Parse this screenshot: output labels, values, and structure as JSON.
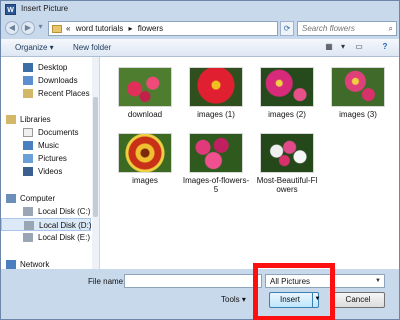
{
  "window": {
    "title": "Insert Picture",
    "app_icon_letter": "W"
  },
  "address": {
    "prefix": "«",
    "segments": [
      "word tutorials",
      "flowers"
    ],
    "separator": "▸",
    "search_placeholder": "Search flowers"
  },
  "toolbar": {
    "organize": "Organize ▾",
    "new_folder": "New folder"
  },
  "nav": {
    "items": [
      {
        "label": "Desktop",
        "icon": "desktop-icon"
      },
      {
        "label": "Downloads",
        "icon": "downloads-icon"
      },
      {
        "label": "Recent Places",
        "icon": "recent-places-icon"
      },
      {
        "label": "Libraries",
        "icon": "libraries-icon"
      },
      {
        "label": "Documents",
        "icon": "documents-icon"
      },
      {
        "label": "Music",
        "icon": "music-icon"
      },
      {
        "label": "Pictures",
        "icon": "pictures-icon"
      },
      {
        "label": "Videos",
        "icon": "videos-icon"
      },
      {
        "label": "Computer",
        "icon": "computer-icon"
      },
      {
        "label": "Local Disk (C:)",
        "icon": "disk-icon"
      },
      {
        "label": "Local Disk (D:)",
        "icon": "disk-icon"
      },
      {
        "label": "Local Disk (E:)",
        "icon": "disk-icon"
      },
      {
        "label": "Network",
        "icon": "network-icon"
      }
    ]
  },
  "files": [
    {
      "name": "download"
    },
    {
      "name": "images (1)"
    },
    {
      "name": "images (2)"
    },
    {
      "name": "images (3)"
    },
    {
      "name": "images"
    },
    {
      "name": "Images-of-flowers-5"
    },
    {
      "name": "Most-Beautiful-Flowers"
    }
  ],
  "bottom": {
    "file_name_label": "File name:",
    "file_name_value": "",
    "filter": "All Pictures",
    "tools": "Tools ▾",
    "insert": "Insert",
    "cancel": "Cancel"
  },
  "colors": {
    "highlight": "#ff1010",
    "accent": "#3c7fb1"
  }
}
